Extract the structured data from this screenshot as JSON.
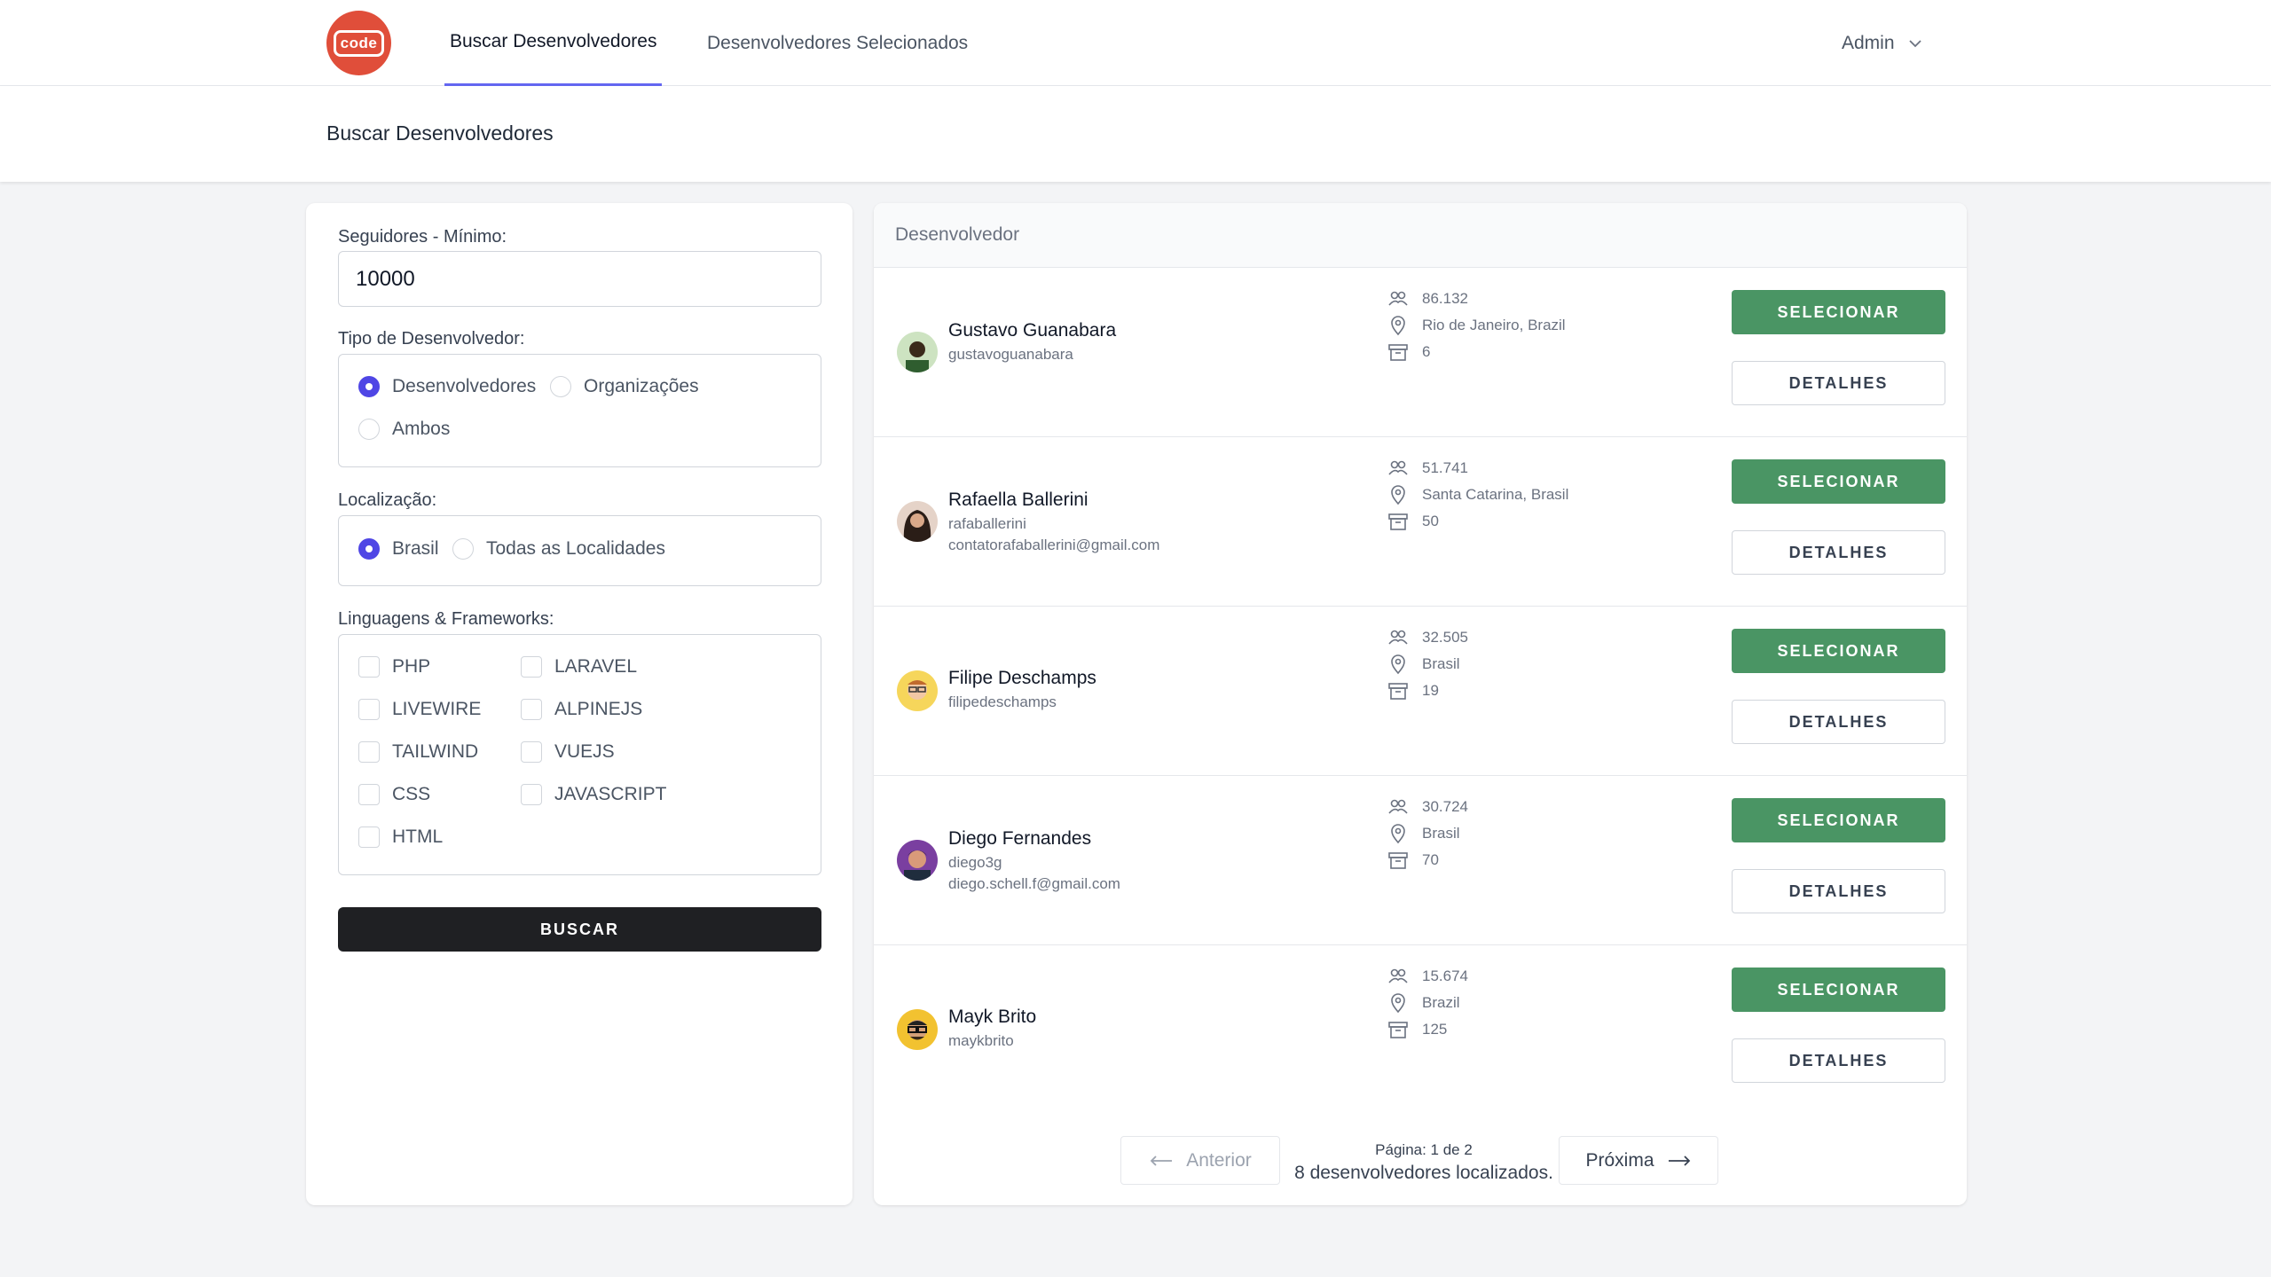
{
  "nav": {
    "logo_text": "code",
    "tabs": [
      {
        "label": "Buscar Desenvolvedores",
        "active": true
      },
      {
        "label": "Desenvolvedores Selecionados",
        "active": false
      }
    ],
    "user_label": "Admin"
  },
  "header": {
    "title": "Buscar Desenvolvedores"
  },
  "filters": {
    "followers_label": "Seguidores - Mínimo:",
    "followers_value": "10000",
    "type_label": "Tipo de Desenvolvedor:",
    "type_options": [
      {
        "label": "Desenvolvedores",
        "checked": true
      },
      {
        "label": "Organizações",
        "checked": false
      },
      {
        "label": "Ambos",
        "checked": false
      }
    ],
    "location_label": "Localização:",
    "location_options": [
      {
        "label": "Brasil",
        "checked": true
      },
      {
        "label": "Todas as Localidades",
        "checked": false
      }
    ],
    "langs_label": "Linguagens & Frameworks:",
    "langs": [
      "PHP",
      "LARAVEL",
      "LIVEWIRE",
      "ALPINEJS",
      "TAILWIND",
      "VUEJS",
      "CSS",
      "JAVASCRIPT",
      "HTML"
    ],
    "search_button": "BUSCAR"
  },
  "results": {
    "header": "Desenvolvedor",
    "select_label": "SELECIONAR",
    "details_label": "DETALHES",
    "items": [
      {
        "name": "Gustavo Guanabara",
        "login": "gustavoguanabara",
        "email": "",
        "followers": "86.132",
        "location": "Rio de Janeiro, Brazil",
        "repos": "6"
      },
      {
        "name": "Rafaella Ballerini",
        "login": "rafaballerini",
        "email": "contatorafaballerini@gmail.com",
        "followers": "51.741",
        "location": "Santa Catarina, Brasil",
        "repos": "50"
      },
      {
        "name": "Filipe Deschamps",
        "login": "filipedeschamps",
        "email": "",
        "followers": "32.505",
        "location": "Brasil",
        "repos": "19"
      },
      {
        "name": "Diego Fernandes",
        "login": "diego3g",
        "email": "diego.schell.f@gmail.com",
        "followers": "30.724",
        "location": "Brasil",
        "repos": "70"
      },
      {
        "name": "Mayk Brito",
        "login": "maykbrito",
        "email": "",
        "followers": "15.674",
        "location": "Brazil",
        "repos": "125"
      }
    ]
  },
  "pagination": {
    "prev_label": "Anterior",
    "next_label": "Próxima",
    "page_text": "Página: 1 de 2",
    "count_text": "8 desenvolvedores localizados."
  },
  "colors": {
    "accent": "#6366f1",
    "select_button": "#4a9564",
    "search_button": "#1f2023",
    "logo": "#e04e3a"
  }
}
